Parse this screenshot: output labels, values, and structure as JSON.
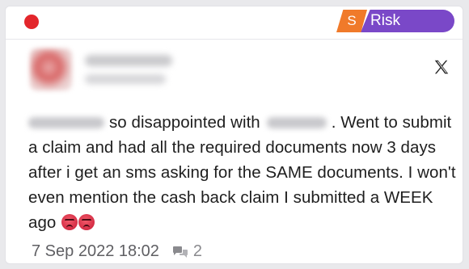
{
  "tag": {
    "letter": "S",
    "label": "Risk",
    "colors": {
      "letter_bg": "#f07a2a",
      "label_bg": "#7a48c8"
    }
  },
  "status_color": "#e3262b",
  "platform_icon": "x-logo-icon",
  "post": {
    "text_1": "so disappointed with",
    "text_2": ". Went to submit a claim and had all the required documents now 3 days after i get an sms asking for the SAME documents. I won't even mention the cash back claim I submitted a WEEK ago",
    "emoji": "angry-face-icon"
  },
  "meta": {
    "date": "7 Sep 2022 18:02",
    "comments_icon": "comments-icon",
    "comment_count": "2"
  }
}
